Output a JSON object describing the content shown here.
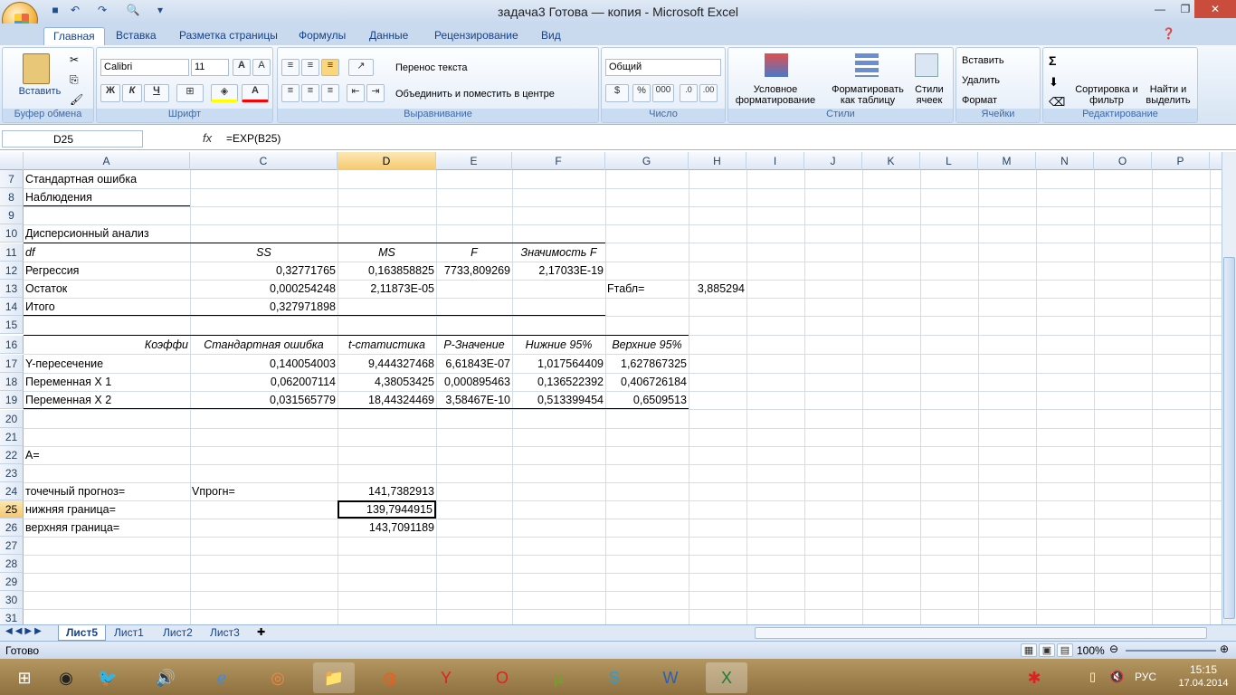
{
  "window": {
    "title": "задача3 Готова — копия - Microsoft Excel"
  },
  "tabs": [
    "Главная",
    "Вставка",
    "Разметка страницы",
    "Формулы",
    "Данные",
    "Рецензирование",
    "Вид"
  ],
  "ribbon": {
    "clipboard": {
      "paste": "Вставить",
      "label": "Буфер обмена"
    },
    "font": {
      "name": "Calibri",
      "size": "11",
      "label": "Шрифт",
      "bold": "Ж",
      "italic": "К",
      "underline": "Ч"
    },
    "alignment": {
      "wrap": "Перенос текста",
      "merge": "Объединить и поместить в центре",
      "label": "Выравнивание"
    },
    "number": {
      "format": "Общий",
      "label": "Число",
      "percent": "%",
      "thousands": "000"
    },
    "styles": {
      "cond": "Условное форматирование",
      "table": "Форматировать как таблицу",
      "cell": "Стили ячеек",
      "label": "Стили"
    },
    "cells": {
      "insert": "Вставить",
      "delete": "Удалить",
      "format": "Формат",
      "label": "Ячейки"
    },
    "editing": {
      "sort": "Сортировка и фильтр",
      "find": "Найти и выделить",
      "label": "Редактирование",
      "sum": "Σ"
    }
  },
  "formula_bar": {
    "name_box": "D25",
    "fx": "fx",
    "formula": "=EXP(B25)"
  },
  "columns": [
    "A",
    "C",
    "D",
    "E",
    "F",
    "G",
    "H",
    "I",
    "J",
    "K",
    "L",
    "M",
    "N",
    "O",
    "P"
  ],
  "rows": [
    "7",
    "8",
    "9",
    "10",
    "11",
    "12",
    "13",
    "14",
    "15",
    "16",
    "17",
    "18",
    "19",
    "20",
    "21",
    "22",
    "23",
    "24",
    "25",
    "26",
    "27",
    "28",
    "29",
    "30",
    "31"
  ],
  "cells": {
    "A7": "Стандартная ошибка",
    "A8": "Наблюдения",
    "A10": "Дисперсионный анализ",
    "A11": "df",
    "C11": "SS",
    "D11": "MS",
    "E11": "F",
    "F11": "Значимость F",
    "A12": "Регрессия",
    "C12": "0,32771765",
    "D12": "0,163858825",
    "E12": "7733,809269",
    "F12": "2,17033E-19",
    "A13": "Остаток",
    "C13": "0,000254248",
    "D13": "2,11873E-05",
    "G13": "Fтабл=",
    "H13": "3,885294",
    "A14": "Итого",
    "C14": "0,327971898",
    "A16": "Коэффи",
    "C16": "Стандартная ошибка",
    "D16": "t-статистика",
    "E16": "P-Значение",
    "F16": "Нижние 95%",
    "G16": "Верхние 95%",
    "A17": "Y-пересечение",
    "C17": "0,140054003",
    "D17": "9,444327468",
    "E17": "6,61843E-07",
    "F17": "1,017564409",
    "G17": "1,627867325",
    "A18": "Переменная X 1",
    "C18": "0,062007114",
    "D18": "4,38053425",
    "E18": "0,000895463",
    "F18": "0,136522392",
    "G18": "0,406726184",
    "A19": "Переменная X 2",
    "C19": "0,031565779",
    "D19": "18,44324469",
    "E19": "3,58467E-10",
    "F19": "0,513399454",
    "G19": "0,6509513",
    "A22": "A=",
    "A24": "точечный прогноз=",
    "C24": "Vпрогн=",
    "D24": "141,7382913",
    "A25": "нижняя граница=",
    "D25": "139,7944915",
    "A26": "верхняя граница=",
    "D26": "143,7091189"
  },
  "sheets": [
    "Лист5",
    "Лист1",
    "Лист2",
    "Лист3"
  ],
  "status": {
    "ready": "Готово",
    "zoom": "100%"
  },
  "tray": {
    "lang": "РУС",
    "time": "15:15",
    "date": "17.04.2014"
  }
}
